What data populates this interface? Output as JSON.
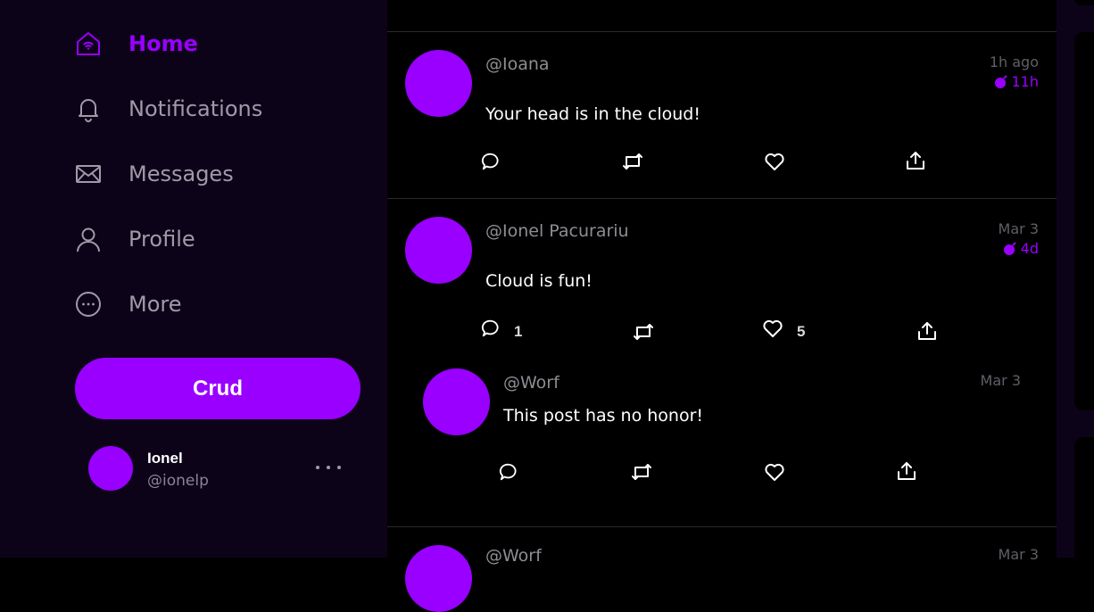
{
  "nav": {
    "items": [
      {
        "label": "Home",
        "icon": "home-icon",
        "active": true
      },
      {
        "label": "Notifications",
        "icon": "bell-icon",
        "active": false
      },
      {
        "label": "Messages",
        "icon": "envelope-icon",
        "active": false
      },
      {
        "label": "Profile",
        "icon": "user-icon",
        "active": false
      },
      {
        "label": "More",
        "icon": "more-circle-icon",
        "active": false
      }
    ],
    "post_button_label": "Crud"
  },
  "current_user": {
    "name": "Ionel",
    "handle": "@ionelp"
  },
  "colors": {
    "accent": "#9900ff",
    "sidebar_bg": "#0d0319",
    "feed_bg": "#000000"
  },
  "posts": [
    {
      "handle": "@Ioana",
      "time": "1h ago",
      "age": "11h",
      "content": "Your head is in the cloud!",
      "replies": "",
      "likes": ""
    },
    {
      "handle": "@Ionel Pacurariu",
      "time": "Mar 3",
      "age": "4d",
      "content": "Cloud is fun!",
      "replies": "1",
      "likes": "5",
      "reply": {
        "handle": "@Worf",
        "time": "Mar 3",
        "content": "This post has no honor!"
      }
    },
    {
      "handle": "@Worf",
      "time": "Mar 3",
      "content": ""
    }
  ]
}
